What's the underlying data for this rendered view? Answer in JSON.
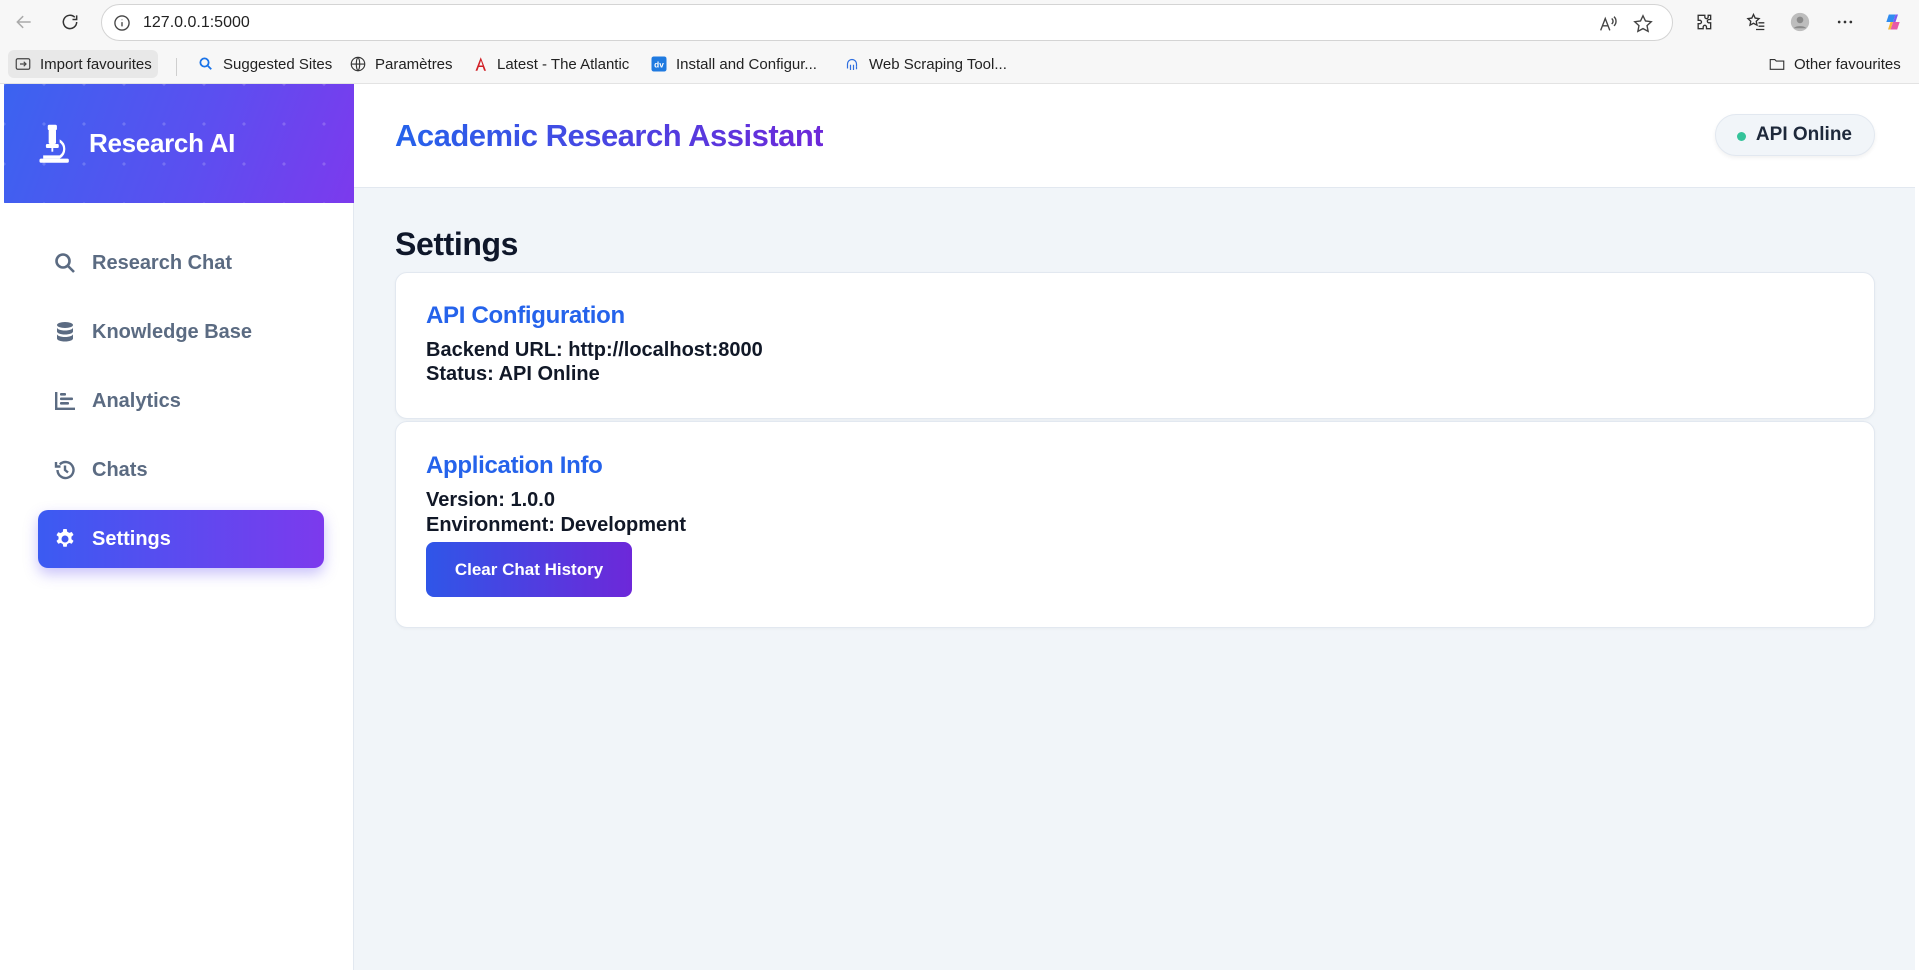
{
  "browser": {
    "url": "127.0.0.1:5000",
    "bookmarks": [
      {
        "label": "Import favourites",
        "icon": "import-icon"
      },
      {
        "label": "Suggested Sites",
        "icon": "search-icon"
      },
      {
        "label": "Paramètres",
        "icon": "globe-icon"
      },
      {
        "label": "Latest - The Atlantic",
        "icon": "atlantic-logo-icon"
      },
      {
        "label": "Install and Configur...",
        "icon": "dv-logo-icon"
      },
      {
        "label": "Web Scraping Tool...",
        "icon": "octopus-icon"
      }
    ],
    "other_favourites": "Other favourites"
  },
  "app": {
    "brand": "Research AI",
    "header_title": "Academic Research Assistant",
    "api_status": "API Online",
    "nav": [
      {
        "label": "Research Chat",
        "icon": "search-icon",
        "active": false
      },
      {
        "label": "Knowledge Base",
        "icon": "database-icon",
        "active": false
      },
      {
        "label": "Analytics",
        "icon": "bar-chart-icon",
        "active": false
      },
      {
        "label": "Chats",
        "icon": "history-icon",
        "active": false
      },
      {
        "label": "Settings",
        "icon": "gear-icon",
        "active": true
      }
    ],
    "accent_colors": {
      "primary": "#2563eb",
      "secondary": "#7c3aed",
      "status_online": "#34c39a"
    }
  },
  "settings": {
    "title": "Settings",
    "api_config": {
      "heading": "API Configuration",
      "backend_url": "Backend URL: http://localhost:8000",
      "status": "Status: API Online"
    },
    "app_info": {
      "heading": "Application Info",
      "version": "Version: 1.0.0",
      "environment": "Environment: Development",
      "clear_button": "Clear Chat History"
    }
  }
}
